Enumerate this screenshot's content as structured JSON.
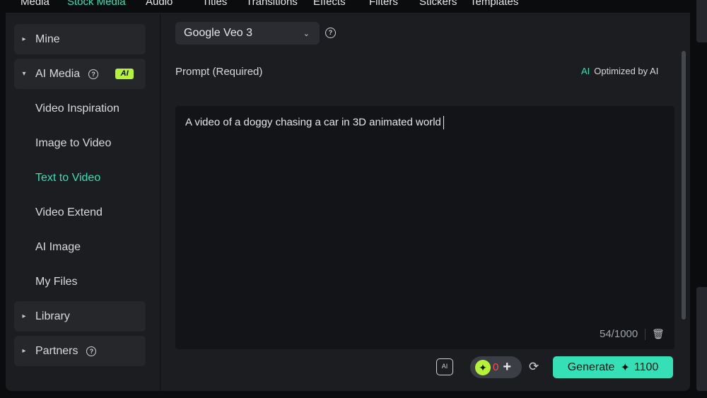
{
  "top_tabs": [
    {
      "label": "Media",
      "active": false
    },
    {
      "label": "Stock Media",
      "active": true
    },
    {
      "label": "Audio",
      "active": false
    },
    {
      "label": "Titles",
      "active": false
    },
    {
      "label": "Transitions",
      "active": false
    },
    {
      "label": "Effects",
      "active": false
    },
    {
      "label": "Filters",
      "active": false
    },
    {
      "label": "Stickers",
      "active": false
    },
    {
      "label": "Templates",
      "active": false
    }
  ],
  "sidebar": {
    "mine": "Mine",
    "ai_media": "AI Media",
    "ai_badge": "AI",
    "items": [
      {
        "label": "Video Inspiration",
        "active": false
      },
      {
        "label": "Image to Video",
        "active": false
      },
      {
        "label": "Text to Video",
        "active": true
      },
      {
        "label": "Video Extend",
        "active": false
      },
      {
        "label": "AI Image",
        "active": false
      },
      {
        "label": "My Files",
        "active": false
      }
    ],
    "library": "Library",
    "partners": "Partners"
  },
  "model_select": {
    "value": "Google Veo 3"
  },
  "prompt": {
    "label": "Prompt (Required)",
    "optimized_icon": "AI",
    "optimized_label": "Optimized by AI",
    "value": "A video of a doggy chasing a car in 3D animated world",
    "counter": "54/1000"
  },
  "toolbar": {
    "ai_image_icon": "AI",
    "credits": "0",
    "generate_label": "Generate",
    "generate_cost": "1100"
  },
  "colors": {
    "accent": "#35e0b6",
    "badge": "#b4f33a",
    "danger": "#ff4b4b"
  }
}
